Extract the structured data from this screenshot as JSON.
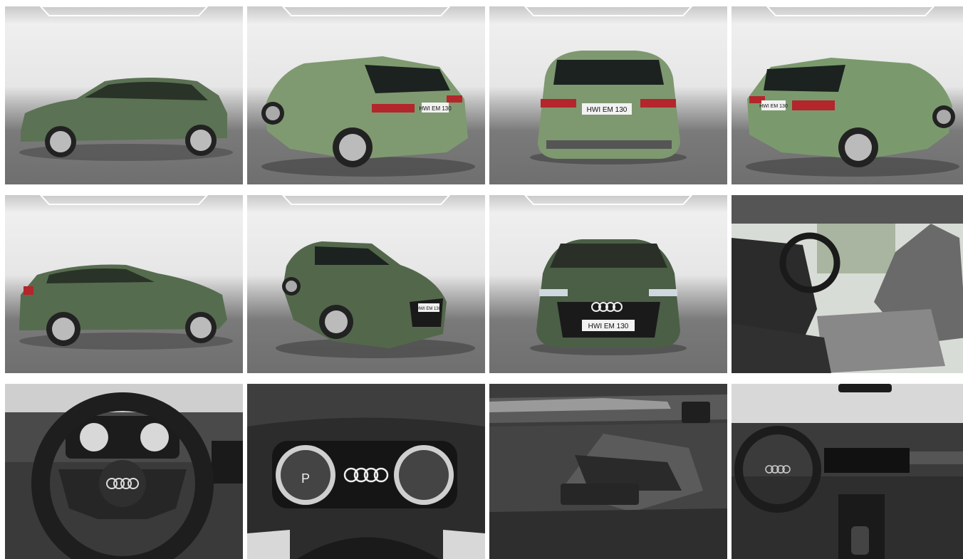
{
  "gallery": {
    "photos": [
      {
        "view": "side-left",
        "setting": "studio",
        "body_color": "#5b7254",
        "plate": ""
      },
      {
        "view": "rear-three-quarter-left",
        "setting": "studio",
        "body_color": "#7f9a70",
        "plate": "HWI EM 130"
      },
      {
        "view": "rear",
        "setting": "studio",
        "body_color": "#7e9870",
        "plate": "HWI EM 130"
      },
      {
        "view": "rear-three-quarter-right",
        "setting": "studio",
        "body_color": "#7a9a6e",
        "plate": "HWI EM 130"
      },
      {
        "view": "side-right",
        "setting": "studio",
        "body_color": "#566c4f",
        "plate": ""
      },
      {
        "view": "front-three-quarter",
        "setting": "studio",
        "body_color": "#53684b",
        "plate": "HWI EM 130"
      },
      {
        "view": "front",
        "setting": "studio",
        "body_color": "#4b5e46",
        "plate": "HWI EM 130"
      },
      {
        "view": "interior-front-seats",
        "setting": "interior",
        "body_color": "#4a4a4a",
        "plate": ""
      },
      {
        "view": "steering-wheel",
        "setting": "interior",
        "body_color": "#2b2b2b",
        "plate": ""
      },
      {
        "view": "instrument-cluster",
        "setting": "interior",
        "body_color": "#2a2a2a",
        "plate": ""
      },
      {
        "view": "door-panel",
        "setting": "interior",
        "body_color": "#3c3c3c",
        "plate": ""
      },
      {
        "view": "dashboard",
        "setting": "interior",
        "body_color": "#2e2e2e",
        "plate": ""
      }
    ],
    "cluster_gear": "P"
  },
  "colors": {
    "floor": "#6f6f6f",
    "wall": "#e8e8e8",
    "accent_taillight": "#b3262b"
  }
}
